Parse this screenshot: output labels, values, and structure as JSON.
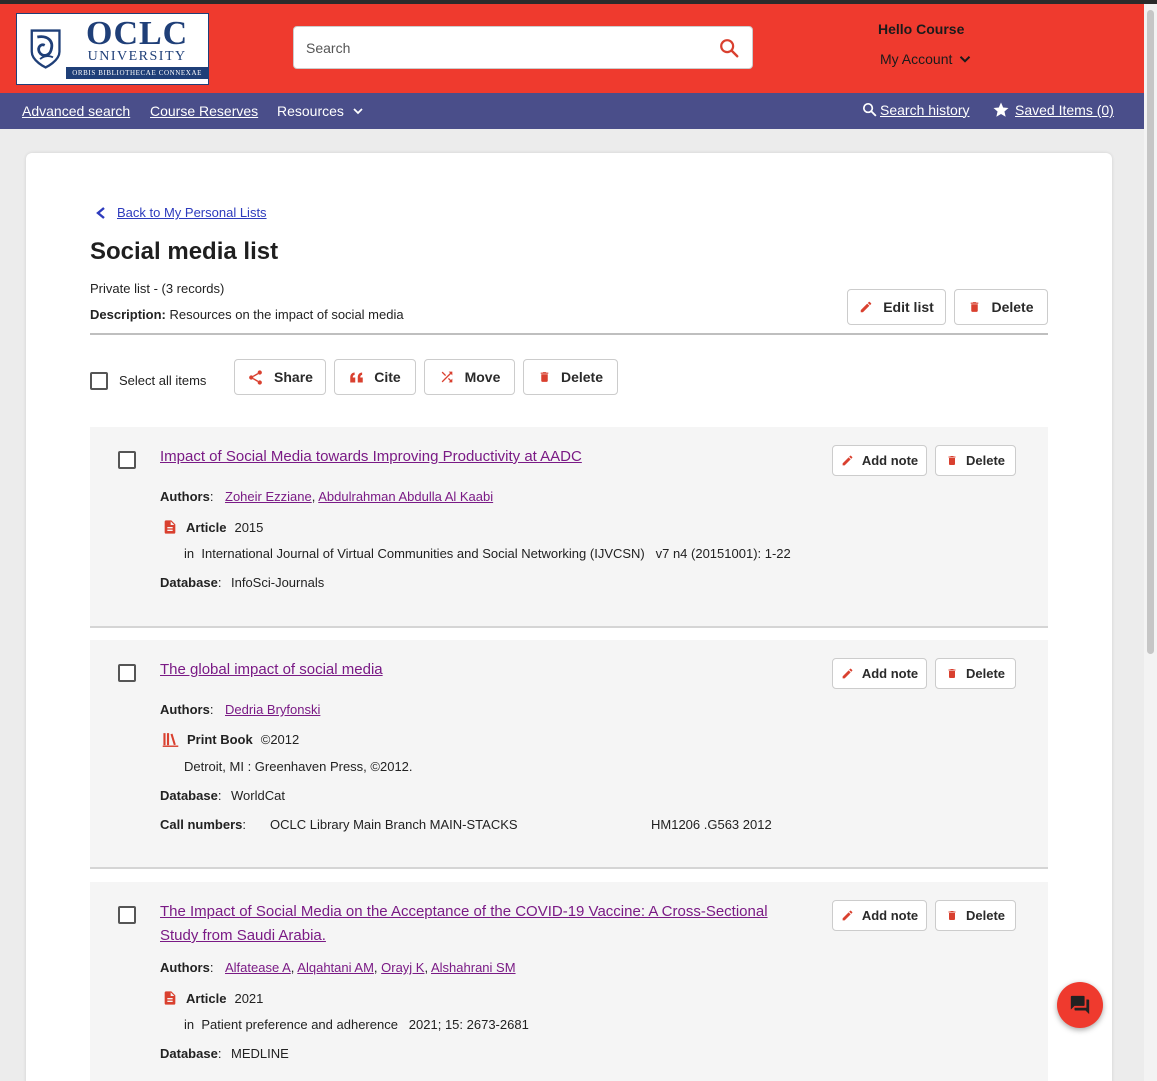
{
  "logo": {
    "text_main": "OCLC",
    "text_sub": "UNIVERSITY",
    "motto": "ORBIS BIBLIOTHECAE CONNEXAE"
  },
  "search": {
    "placeholder": "Search"
  },
  "user": {
    "greeting": "Hello Course",
    "account_label": "My Account"
  },
  "nav": {
    "advanced_search": "Advanced search",
    "course_reserves": "Course Reserves",
    "resources": "Resources",
    "search_history": "Search history",
    "saved_items": "Saved Items (0)"
  },
  "list": {
    "back_link": "Back to My Personal Lists",
    "title": "Social media list",
    "privacy": "Private list - (3 records)",
    "description_label": "Description:",
    "description": "Resources on the impact of social media",
    "edit_label": "Edit list",
    "delete_label": "Delete"
  },
  "toolbar": {
    "select_all": "Select all items",
    "share": "Share",
    "cite": "Cite",
    "move": "Move",
    "delete": "Delete"
  },
  "item_actions": {
    "add_note": "Add note",
    "delete": "Delete"
  },
  "labels": {
    "authors": "Authors",
    "database": "Database",
    "call_numbers": "Call numbers",
    "in": "in"
  },
  "records": [
    {
      "title": "Impact of Social Media towards Improving Productivity at AADC",
      "authors": [
        "Zoheir Ezziane",
        "Abdulrahman Abdulla Al Kaabi"
      ],
      "format": "Article",
      "year": "2015",
      "source": "International Journal of Virtual Communities and Social Networking (IJVCSN)",
      "source_detail": "v7 n4 (20151001): 1-22",
      "database": "InfoSci-Journals"
    },
    {
      "title": "The global impact of social media",
      "authors": [
        "Dedria Bryfonski"
      ],
      "format": "Print Book",
      "year": "©2012",
      "publisher": "Detroit, MI : Greenhaven Press, ©2012.",
      "database": "WorldCat",
      "call_location": "OCLC Library Main Branch MAIN-STACKS",
      "call_number": "HM1206 .G563 2012"
    },
    {
      "title_line1": "The Impact of Social Media on the Acceptance of the COVID-19 Vaccine: A Cross-Sectional",
      "title_line2": "Study from Saudi Arabia.",
      "authors": [
        "Alfatease A",
        "Alqahtani AM",
        "Orayj K",
        "Alshahrani SM"
      ],
      "format": "Article",
      "year": "2021",
      "source": "Patient preference and adherence",
      "source_detail": "2021; 15: 2673-2681",
      "database": "MEDLINE"
    }
  ],
  "colors": {
    "header": "#ef3a2e",
    "nav": "#4a4e8a",
    "link_visited": "#7a1a85",
    "accent_red": "#d9402f"
  }
}
